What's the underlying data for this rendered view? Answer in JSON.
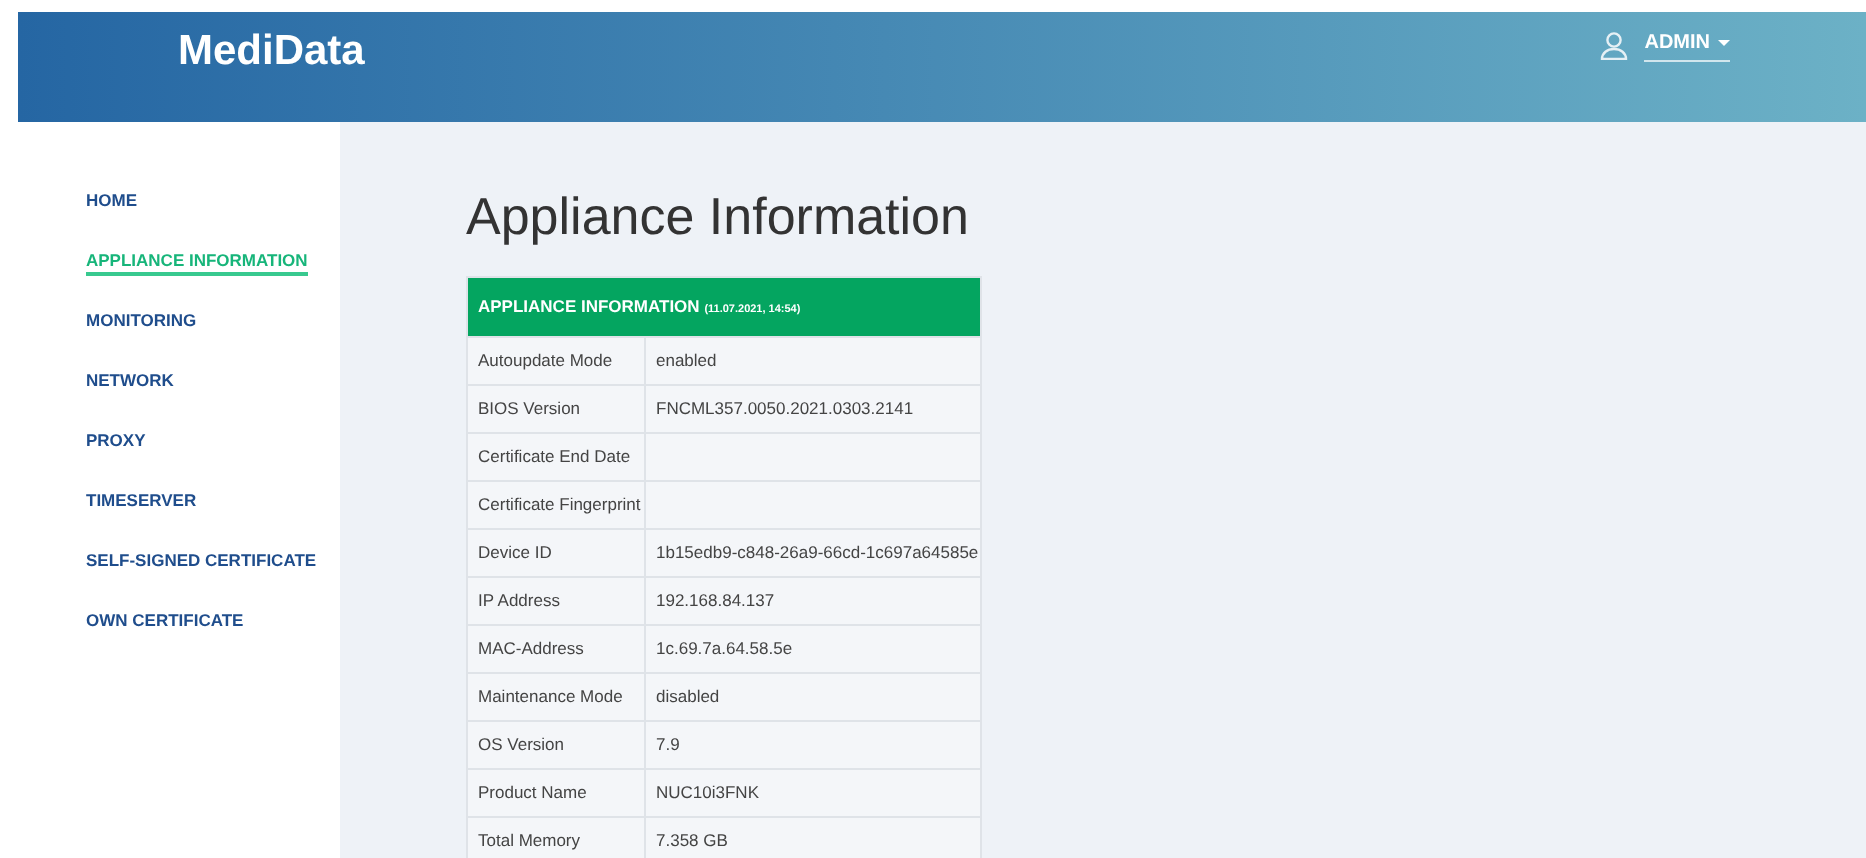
{
  "header": {
    "logo": "MediData",
    "user": "ADMIN"
  },
  "sidebar": {
    "items": [
      {
        "label": "HOME",
        "selected": false
      },
      {
        "label": "APPLIANCE INFORMATION",
        "selected": true
      },
      {
        "label": "MONITORING",
        "selected": false
      },
      {
        "label": "NETWORK",
        "selected": false
      },
      {
        "label": "PROXY",
        "selected": false
      },
      {
        "label": "TIMESERVER",
        "selected": false
      },
      {
        "label": "SELF-SIGNED CERTIFICATE",
        "selected": false
      },
      {
        "label": "OWN CERTIFICATE",
        "selected": false
      }
    ]
  },
  "page_title": "Appliance Information",
  "table": {
    "title": "APPLIANCE INFORMATION",
    "timestamp": "(11.07.2021, 14:54)",
    "rows": [
      {
        "label": "Autoupdate Mode",
        "value": "enabled"
      },
      {
        "label": "BIOS Version",
        "value": "FNCML357.0050.2021.0303.2141"
      },
      {
        "label": "Certificate End Date"
      },
      {
        "label": "Certificate Fingerprint"
      },
      {
        "label": "Device ID",
        "value": "1b15edb9-c848-26a9-66cd-1c697a64585e"
      },
      {
        "label": "IP Address",
        "value": "192.168.84.137"
      },
      {
        "label": "MAC-Address",
        "value": "1c.69.7a.64.58.5e"
      },
      {
        "label": "Maintenance Mode",
        "value": "disabled"
      },
      {
        "label": "OS Version",
        "value": "7.9"
      },
      {
        "label": "Product Name",
        "value": "NUC10i3FNK"
      },
      {
        "label": "Total Memory",
        "value": "7.358 GB"
      }
    ]
  }
}
